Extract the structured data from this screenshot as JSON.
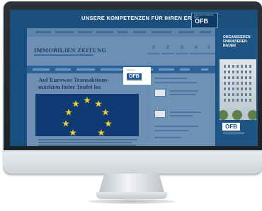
{
  "banner": {
    "tagline": "UNSERE KOMPETENZEN FÜR IHREN ERFOLG",
    "logo_top": "Organisieren Finanzieren Bauen",
    "logo": "OFB"
  },
  "page": {
    "masthead": "IMMOBILIEN ZEITUNG",
    "stats": [
      "2",
      "2",
      "3",
      "4",
      "1"
    ],
    "headline": "Auf Eurowas Transaktions-\nmärkten löder Teufel los"
  },
  "popup": {
    "logo_top": "Teilnahme",
    "logo": "OFB"
  },
  "sidebar": {
    "text": "ORGANISIEREN\nFINANZIEREN\nBAUEN",
    "logo": "OFB"
  },
  "colors": {
    "banner": "#1d4f7d",
    "nav": "#2d6196",
    "eu_flag": "#0f3a73",
    "stars": "#f3cf2b"
  }
}
